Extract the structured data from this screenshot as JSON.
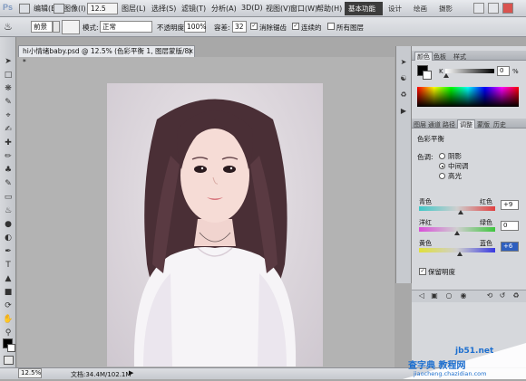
{
  "menu": {
    "app_logo": "Ps",
    "items": [
      "编辑(E)",
      "图像(I)",
      "图层(L)",
      "选择(S)",
      "滤镜(T)",
      "分析(A)",
      "3D(D)",
      "视图(V)",
      "窗口(W)",
      "帮助(H)"
    ],
    "zoom_value": "12.5",
    "workspace_active": "基本功能",
    "workspace_tabs": [
      "设计",
      "绘画",
      "摄影"
    ]
  },
  "options": {
    "foreground_label": "前景",
    "mode_label": "模式:",
    "mode_value": "正常",
    "opacity_label": "不透明度:",
    "opacity_value": "100%",
    "tolerance_label": "容差:",
    "tolerance_value": "32",
    "antialias_label": "消除锯齿",
    "contiguous_label": "连续的",
    "all_layers_label": "所有图层"
  },
  "document": {
    "tab_title": "hi小情绪baby.psd @ 12.5% (色彩平衡 1, 图层蒙版/8) *",
    "close_glyph": "×"
  },
  "status": {
    "zoom": "12.5%",
    "doc_size": "文档:34.4M/102.1M"
  },
  "color_panel": {
    "tabs": [
      "颜色",
      "色板",
      "样式"
    ],
    "channel_label": "K",
    "value": "0",
    "unit": "%"
  },
  "adjust_panel": {
    "tabs": [
      "图层",
      "通道",
      "路径",
      "调整",
      "蒙版",
      "历史"
    ],
    "active_tab": "调整",
    "title": "色彩平衡",
    "tone_label": "色调:",
    "tones": [
      "阴影",
      "中间调",
      "高光"
    ],
    "selected_tone": "中间调",
    "sliders": [
      {
        "left": "青色",
        "right": "红色",
        "value": "+9",
        "level": 9,
        "colors": [
          "#3fc7c7",
          "#e04040"
        ]
      },
      {
        "left": "洋红",
        "right": "绿色",
        "value": "0",
        "level": 0,
        "colors": [
          "#d94fd9",
          "#3fc53f"
        ]
      },
      {
        "left": "黄色",
        "right": "蓝色",
        "value": "+6",
        "level": 6,
        "colors": [
          "#e0e03a",
          "#3a3ae0"
        ]
      }
    ],
    "preserve_label": "保留明度"
  },
  "watermark": {
    "line1": "查字典 教程网",
    "line2": "jb51.net",
    "line3": "jiaocheng.chazidian.com"
  },
  "colors": {
    "accent_active": "#3c3c3c",
    "panel_bg": "#d6d8dc",
    "canvas_bg": "#b3b3b3"
  }
}
